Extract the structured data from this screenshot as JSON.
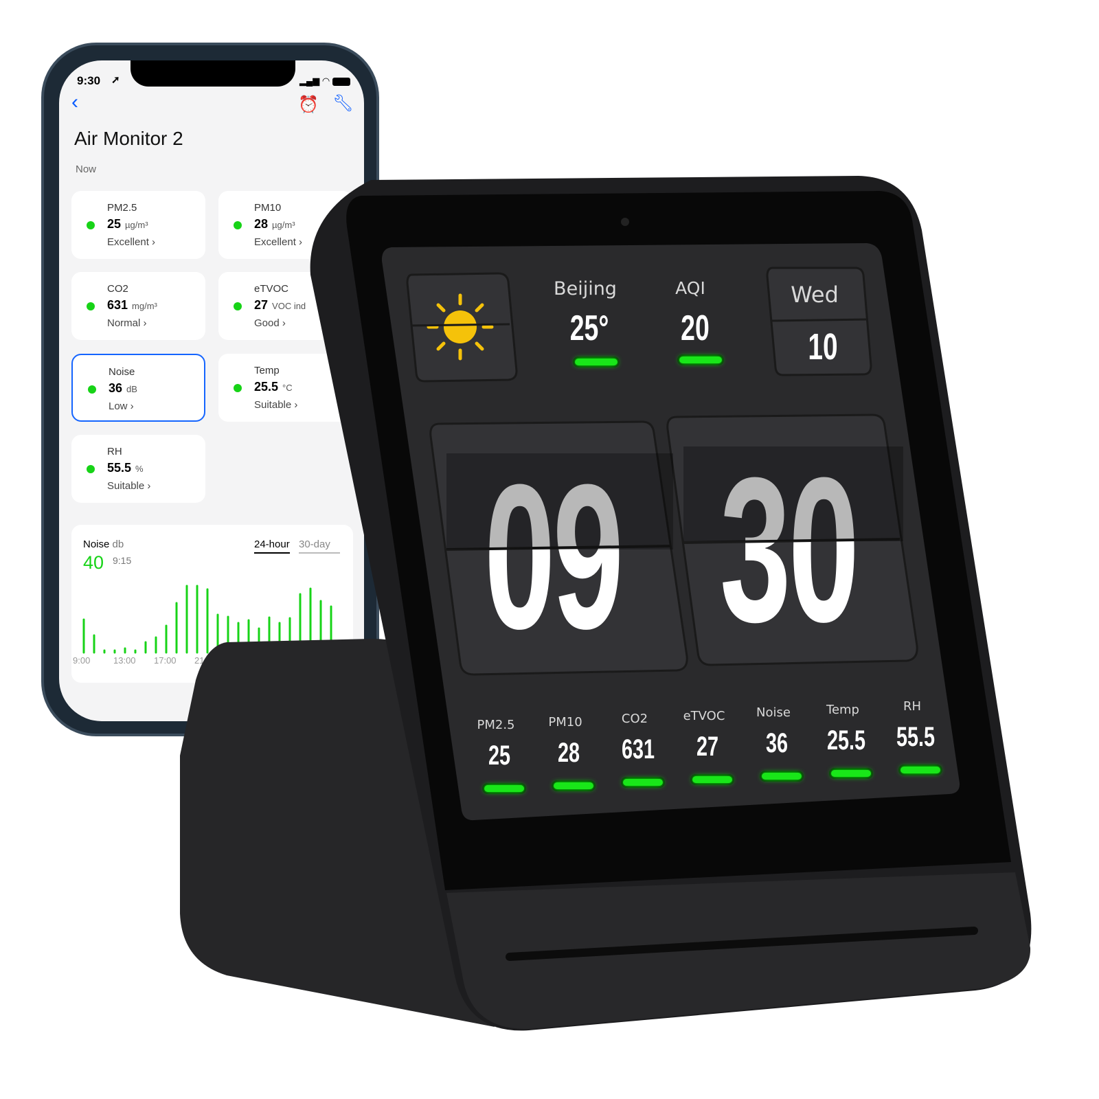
{
  "phone": {
    "status": {
      "time": "9:30"
    },
    "title": "Air Monitor 2",
    "section": "Now",
    "cards": [
      {
        "label": "PM2.5",
        "value": "25",
        "unit": "µg/m³",
        "status": "Excellent ›"
      },
      {
        "label": "PM10",
        "value": "28",
        "unit": "µg/m³",
        "status": "Excellent ›"
      },
      {
        "label": "CO2",
        "value": "631",
        "unit": "mg/m³",
        "status": "Normal ›"
      },
      {
        "label": "eTVOC",
        "value": "27",
        "unit": "VOC ind",
        "status": "Good ›"
      },
      {
        "label": "Noise",
        "value": "36",
        "unit": "dB",
        "status": "Low ›"
      },
      {
        "label": "Temp",
        "value": "25.5",
        "unit": "°C",
        "status": "Suitable ›"
      },
      {
        "label": "RH",
        "value": "55.5",
        "unit": "%",
        "status": "Suitable ›"
      }
    ],
    "chart": {
      "title": "Noise",
      "unit": "db",
      "current": "40",
      "time": "9:15",
      "tabs": [
        "24-hour",
        "30-day"
      ],
      "active_tab": "24-hour",
      "x_ticks": [
        "9:00",
        "13:00",
        "17:00",
        "21:00"
      ],
      "accent": "#17d317"
    }
  },
  "chart_data": {
    "type": "bar",
    "title": "Noise db",
    "xlabel": "",
    "ylabel": "",
    "x_ticks": [
      "9:00",
      "13:00",
      "17:00",
      "21:00"
    ],
    "values": [
      48,
      25,
      3,
      3,
      6,
      3,
      15,
      22,
      39,
      72,
      97,
      97,
      92,
      55,
      52,
      43,
      47,
      35,
      51,
      43,
      50,
      85,
      93,
      75,
      67
    ]
  },
  "device": {
    "city": "Beijing",
    "temp": "25°",
    "aqi_label": "AQI",
    "aqi": "20",
    "weekday": "Wed",
    "day": "10",
    "hour": "09",
    "minute": "30",
    "metrics": [
      {
        "label": "PM2.5",
        "value": "25"
      },
      {
        "label": "PM10",
        "value": "28"
      },
      {
        "label": "CO2",
        "value": "631"
      },
      {
        "label": "eTVOC",
        "value": "27"
      },
      {
        "label": "Noise",
        "value": "36"
      },
      {
        "label": "Temp",
        "value": "25.5"
      },
      {
        "label": "RH",
        "value": "55.5"
      }
    ],
    "indicator_color": "#19e619",
    "weather_icon": "sun-icon"
  }
}
